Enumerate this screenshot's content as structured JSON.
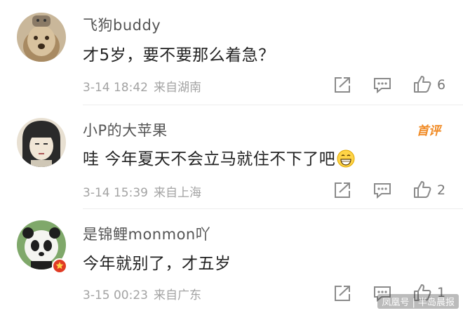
{
  "comments": [
    {
      "username": "飞狗buddy",
      "text": "才5岁，要不要那么着急？",
      "time": "3-14 18:42",
      "location": "来自湖南",
      "likes": "6",
      "avatar_icon": "dog-avatar-icon"
    },
    {
      "username": "小P的大苹果",
      "badge": "首评",
      "text": "哇 今年夏天不会立马就住不下了吧",
      "emoji_icon": "grinning-emoji-icon",
      "time": "3-14 15:39",
      "location": "来自上海",
      "likes": "2",
      "avatar_icon": "cartoon-girl-avatar-icon"
    },
    {
      "username": "是锦鲤monmon吖",
      "text": "今年就别了，才五岁",
      "time": "3-15 00:23",
      "location": "来自广东",
      "likes": "1",
      "avatar_icon": "panda-avatar-icon",
      "badge_icon": "verified-star-icon"
    }
  ],
  "watermark": "凤凰号 | 半岛晨报",
  "colors": {
    "username": "#555555",
    "text": "#222222",
    "meta": "#a3a3a3",
    "badge_first": "#f08a24",
    "verified_badge": "#e03b24"
  }
}
